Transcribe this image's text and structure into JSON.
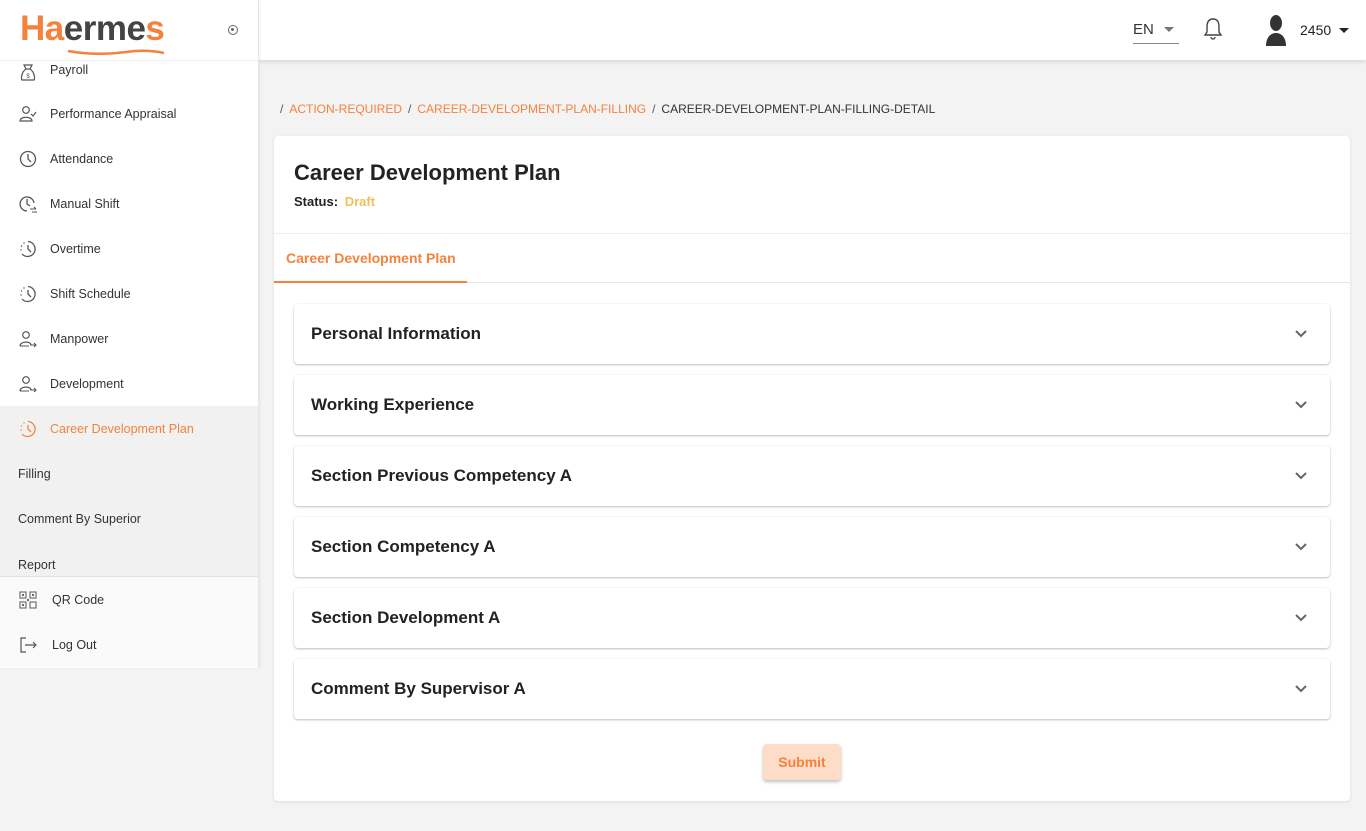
{
  "app": {
    "logo_primary": "Ha",
    "logo_secondary": "erme",
    "logo_tail": "s",
    "brand_color": "#f5823c"
  },
  "sidebar": {
    "items": [
      {
        "label": "Payroll",
        "icon": "money-bag-icon"
      },
      {
        "label": "Performance Appraisal",
        "icon": "user-check-icon"
      },
      {
        "label": "Attendance",
        "icon": "clock-icon"
      },
      {
        "label": "Manual Shift",
        "icon": "clock-swap-icon"
      },
      {
        "label": "Overtime",
        "icon": "clock-dashed-icon"
      },
      {
        "label": "Shift Schedule",
        "icon": "clock-dashed-icon"
      },
      {
        "label": "Manpower",
        "icon": "user-arrow-icon"
      },
      {
        "label": "Development",
        "icon": "user-arrow-icon"
      },
      {
        "label": "Career Development Plan",
        "icon": "clock-dashed-icon",
        "active": true
      }
    ],
    "sub_items": [
      {
        "label": "Filling"
      },
      {
        "label": "Comment By Superior"
      },
      {
        "label": "Report"
      }
    ],
    "bottom_items": [
      {
        "label": "QR Code",
        "icon": "qr-code-icon"
      },
      {
        "label": "Log Out",
        "icon": "logout-icon"
      }
    ]
  },
  "header": {
    "language": "EN",
    "user_id": "2450"
  },
  "breadcrumb": {
    "items": [
      {
        "label": "ACTION-REQUIRED",
        "link": true
      },
      {
        "label": "CAREER-DEVELOPMENT-PLAN-FILLING",
        "link": true
      },
      {
        "label": "CAREER-DEVELOPMENT-PLAN-FILLING-DETAIL",
        "link": false
      }
    ]
  },
  "main": {
    "title": "Career Development Plan",
    "status_label": "Status:",
    "status_value": "Draft",
    "status_color": "#f0c05a",
    "tabs": [
      {
        "label": "Career Development Plan",
        "active": true
      }
    ],
    "sections": [
      {
        "title": "Personal Information"
      },
      {
        "title": "Working Experience"
      },
      {
        "title": "Section Previous Competency A"
      },
      {
        "title": "Section Competency A"
      },
      {
        "title": "Section Development A"
      },
      {
        "title": "Comment By Supervisor A"
      }
    ],
    "submit_label": "Submit"
  }
}
